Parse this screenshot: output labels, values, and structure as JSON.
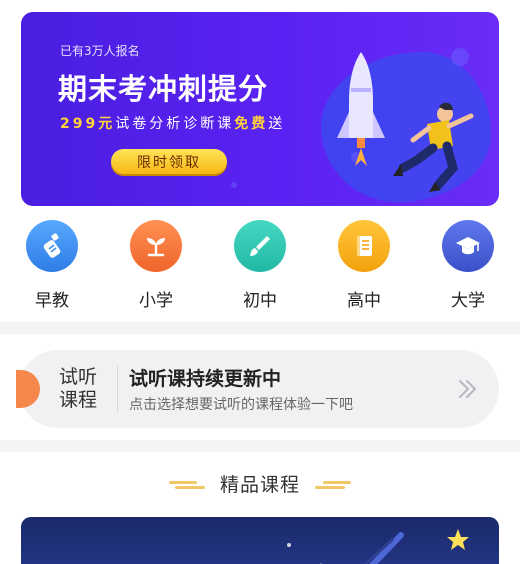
{
  "banner": {
    "subtitle": "已有3万人报名",
    "title": "期末考冲刺提分",
    "promo_price": "299元",
    "promo_mid": "试卷分析诊断课",
    "promo_free": "免费",
    "promo_end": "送",
    "button_label": "限时领取"
  },
  "categories": [
    {
      "label": "早教",
      "icon": "bottle-icon",
      "color": "#3a8ff0"
    },
    {
      "label": "小学",
      "icon": "sprout-icon",
      "color": "#f57a3d"
    },
    {
      "label": "初中",
      "icon": "brush-icon",
      "color": "#2fc7b2"
    },
    {
      "label": "高中",
      "icon": "book-icon",
      "color": "#f7b21c"
    },
    {
      "label": "大学",
      "icon": "graduation-cap-icon",
      "color": "#4b63d8"
    }
  ],
  "trial": {
    "tag_line1": "试听",
    "tag_line2": "课程",
    "title": "试听课持续更新中",
    "description": "点击选择想要试听的课程体验一下吧"
  },
  "section": {
    "title": "精品课程"
  },
  "colors": {
    "banner_bg": "#5a22f2",
    "accent_yellow": "#ffd43a",
    "trial_accent": "#f5874a"
  }
}
